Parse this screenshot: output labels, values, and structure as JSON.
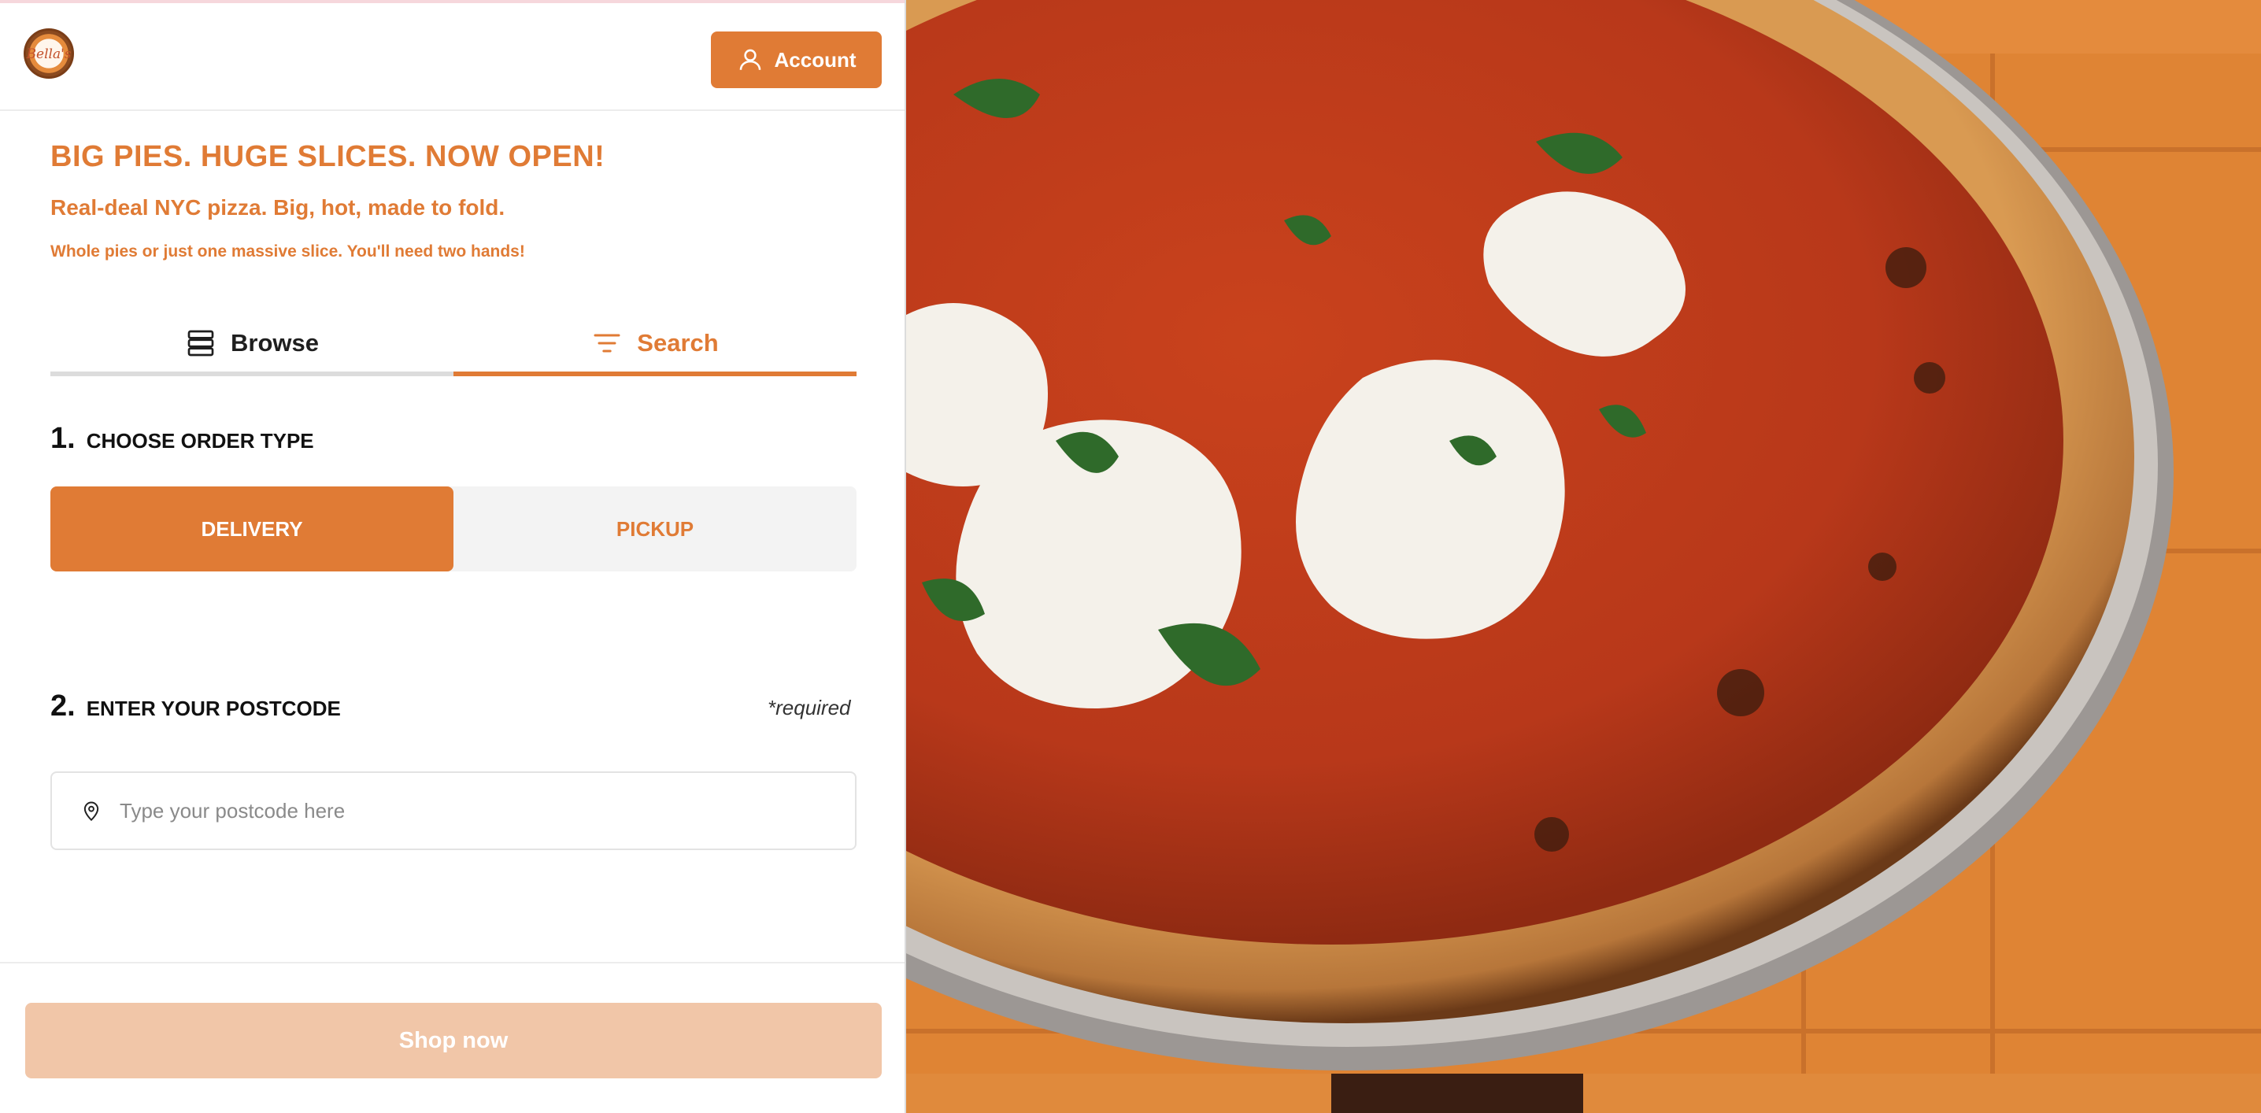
{
  "header": {
    "logo_text": "Bella's",
    "account_label": "Account"
  },
  "hero_text": {
    "headline": "BIG PIES. HUGE SLICES. NOW OPEN!",
    "subheadline": "Real-deal NYC pizza. Big, hot, made to fold.",
    "tagline": "Whole pies or just one massive slice. You'll need two hands!"
  },
  "tabs": [
    {
      "label": "Browse",
      "icon": "list-icon",
      "active": false
    },
    {
      "label": "Search",
      "icon": "filter-icon",
      "active": true
    }
  ],
  "step1": {
    "number": "1.",
    "label": "CHOOSE ORDER TYPE",
    "options": [
      "DELIVERY",
      "PICKUP"
    ],
    "selected": "DELIVERY"
  },
  "step2": {
    "number": "2.",
    "label": "ENTER YOUR POSTCODE",
    "required_label": "*required",
    "placeholder": "Type your postcode here",
    "value": ""
  },
  "footer": {
    "shop_label": "Shop now"
  },
  "colors": {
    "accent": "#e07b35",
    "disabled_button": "#f1c6a8",
    "tab_inactive_line": "#dcdcdc"
  },
  "hero_image": {
    "description_icon": "pizza-photo"
  }
}
